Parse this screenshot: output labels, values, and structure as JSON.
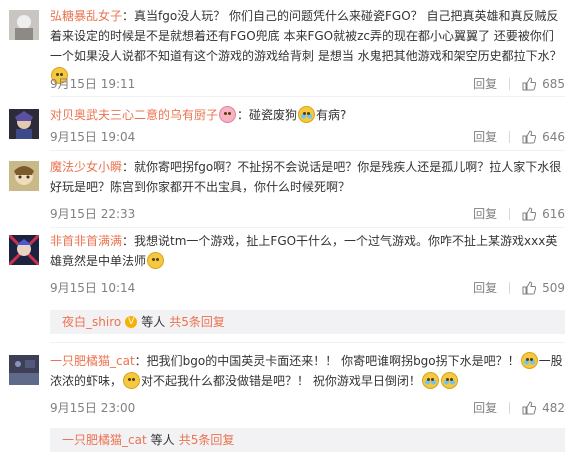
{
  "comments": [
    {
      "user": "弘糖暴乱女子",
      "seg1": "：真当fgo没人玩？ 你们自己的问题凭什么来碰瓷FGO？ 自己把真英雄和真反贼反着来设定的时候是不是就想着还有FGO兜底 本来FGO就被zc弄的现在都小心翼翼了 还要被你们一个如果没人说都不知道有这个游戏的游戏给背刺  是想当 水鬼把其他游戏和架空历史都拉下水？",
      "time": "9月15日 19:11",
      "reply": "回复",
      "likes": "685"
    },
    {
      "user": "对贝奥武夫三心二意的乌有厨子",
      "seg1": "：碰瓷废狗",
      "seg2": "有病?",
      "time": "9月15日 19:04",
      "reply": "回复",
      "likes": "646"
    },
    {
      "user": "魔法少女小瞬",
      "seg1": "：就你寄吧拐fgo啊？不扯拐不会说话是吧？你是残疾人还是孤儿啊？拉人家下水很好玩是吧？陈宫到你家都开不出宝具，你什么时候死啊？",
      "time": "9月15日 22:33",
      "reply": "回复",
      "likes": "616"
    },
    {
      "user": "非首非首满满",
      "seg1": "：我想说tm一个游戏，扯上FGO干什么，一个过气游戏。你咋不扯上某游戏xxx英雄竟然是中单法师",
      "time": "9月15日 10:14",
      "reply": "回复",
      "likes": "509",
      "sub": {
        "name": "夜白_shiro",
        "others": "等人",
        "more": "共5条回复"
      }
    },
    {
      "user": "一只肥橘猫_cat",
      "seg1": "：把我们bgo的中国英灵卡面还来！！ 你寄吧谁啊拐bgo拐下水是吧？！",
      "seg2": "一股浓浓的虾味，",
      "seg3": "对不起我什么都没做错是吧？！ 祝你游戏早日倒闭！",
      "time": "9月15日 23:00",
      "reply": "回复",
      "likes": "482",
      "sub": {
        "name": "一只肥橘猫_cat",
        "others": "等人",
        "more": "共5条回复"
      }
    }
  ],
  "colors": {
    "username": "#eb7350",
    "meta": "#808080",
    "subbox": "#f2f2f5"
  }
}
